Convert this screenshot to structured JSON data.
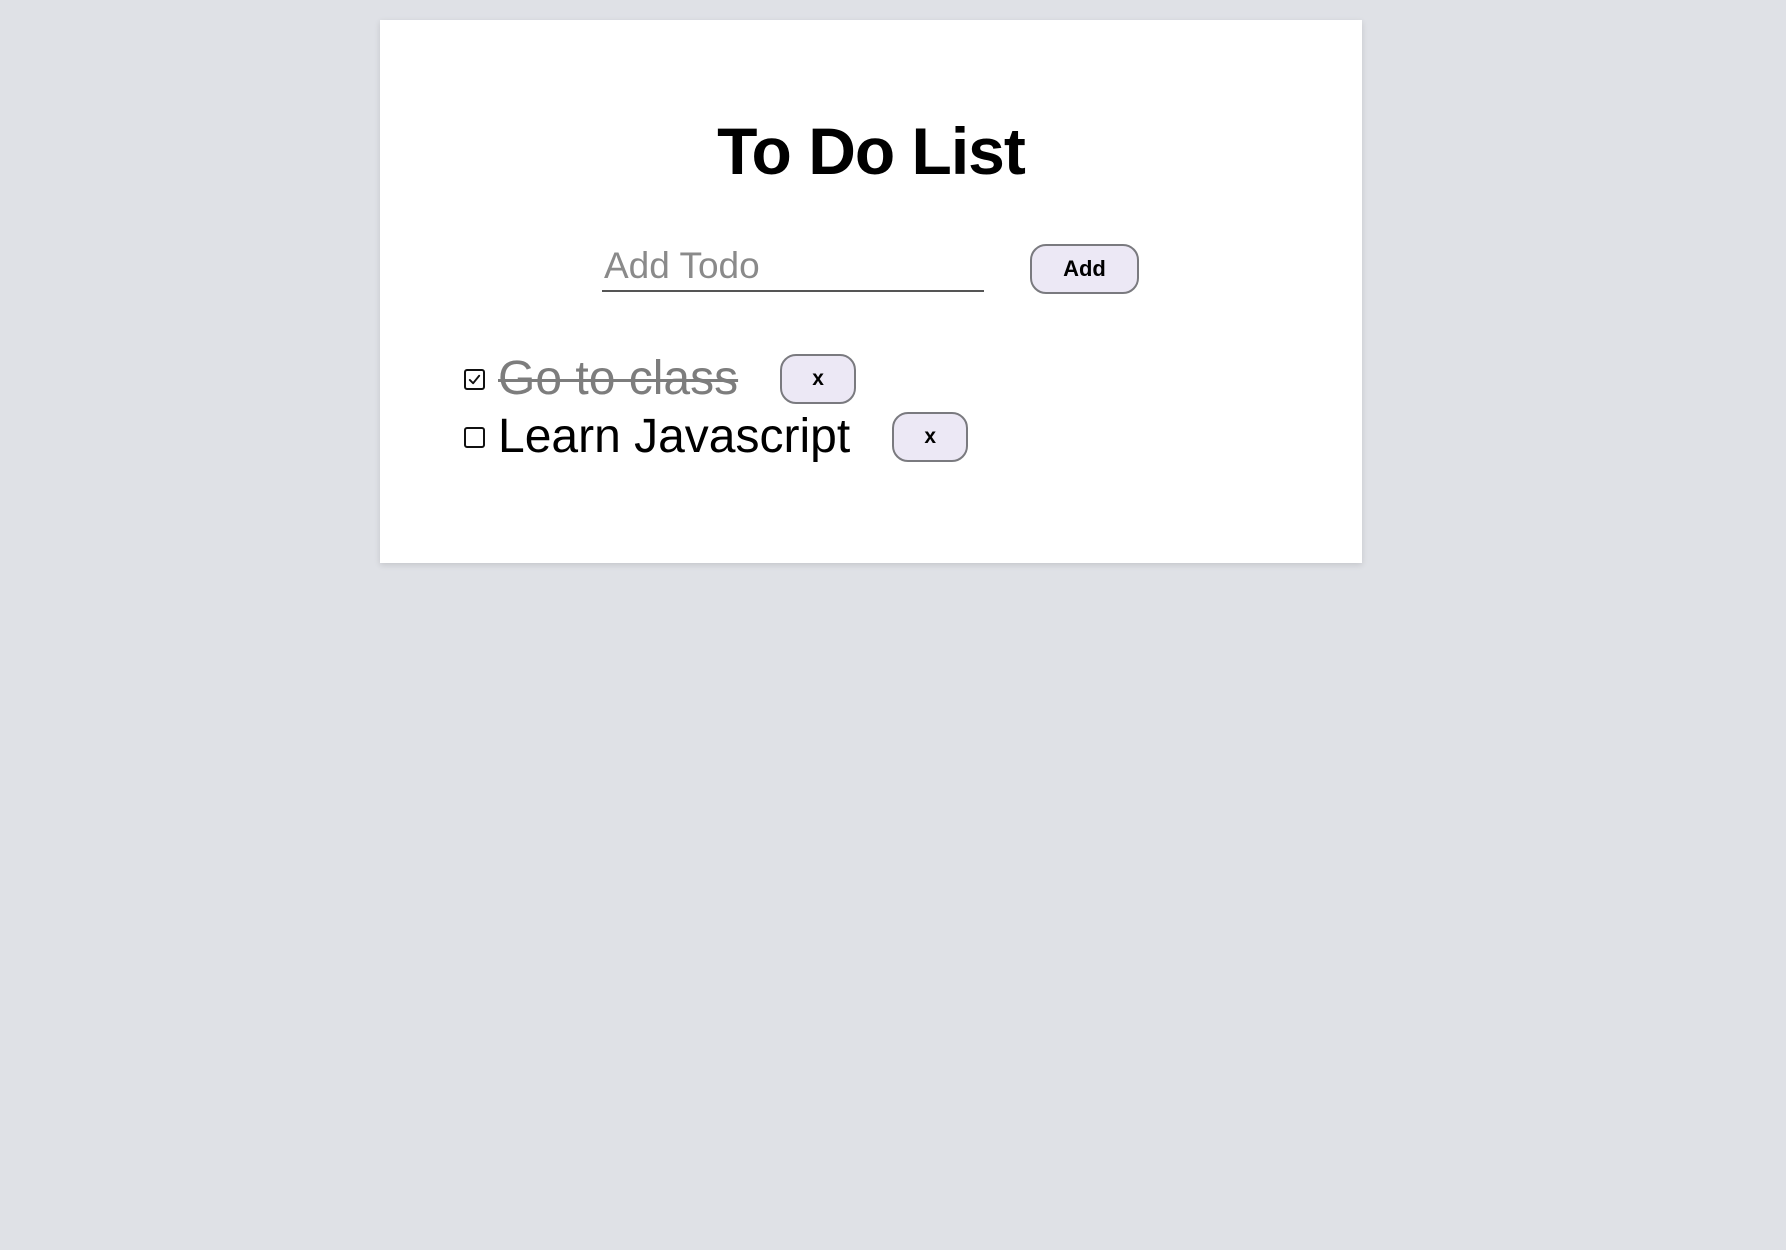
{
  "page": {
    "title": "To Do List"
  },
  "form": {
    "input_value": "",
    "input_placeholder": "Add Todo",
    "add_label": "Add"
  },
  "todos": [
    {
      "text": "Go to class",
      "completed": true,
      "delete_label": "x"
    },
    {
      "text": "Learn Javascript",
      "completed": false,
      "delete_label": "x"
    }
  ],
  "icons": {
    "checked": "check-icon"
  },
  "colors": {
    "background": "#dfe1e6",
    "card": "#ffffff",
    "button_fill": "#ece8f5",
    "button_border": "#7a7a7f",
    "completed_text": "#7d7d7d"
  }
}
